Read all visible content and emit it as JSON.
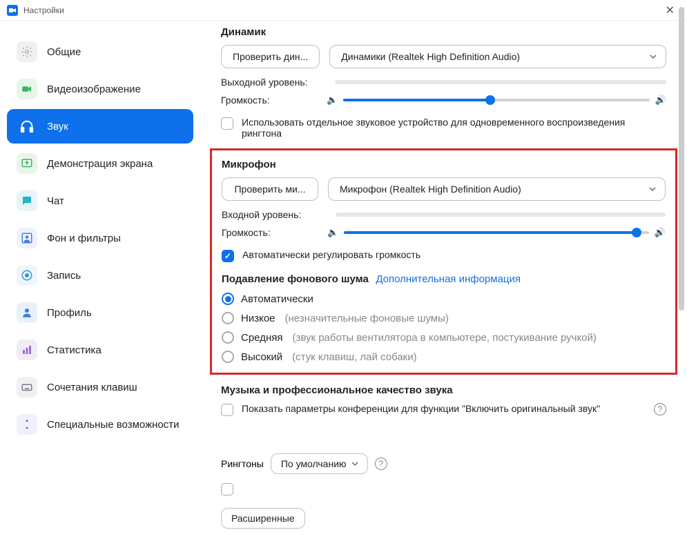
{
  "window": {
    "title": "Настройки"
  },
  "sidebar": {
    "items": [
      {
        "label": "Общие"
      },
      {
        "label": "Видеоизображение"
      },
      {
        "label": "Звук"
      },
      {
        "label": "Демонстрация экрана"
      },
      {
        "label": "Чат"
      },
      {
        "label": "Фон и фильтры"
      },
      {
        "label": "Запись"
      },
      {
        "label": "Профиль"
      },
      {
        "label": "Статистика"
      },
      {
        "label": "Сочетания клавиш"
      },
      {
        "label": "Специальные возможности"
      }
    ]
  },
  "speaker": {
    "heading": "Динамик",
    "test_btn": "Проверить дин...",
    "device": "Динамики (Realtek High Definition Audio)",
    "output_level_label": "Выходной уровень:",
    "volume_label": "Громкость:",
    "volume_percent": 48,
    "separate_ringer_label": "Использовать отдельное звуковое устройство для одновременного воспроизведения рингтона"
  },
  "mic": {
    "heading": "Микрофон",
    "test_btn": "Проверить ми...",
    "device": "Микрофон (Realtek High Definition Audio)",
    "input_level_label": "Входной уровень:",
    "volume_label": "Громкость:",
    "volume_percent": 96,
    "auto_adjust_label": "Автоматически регулировать громкость",
    "noise_heading": "Подавление фонового шума",
    "noise_link": "Дополнительная информация",
    "opts": [
      {
        "label": "Автоматически",
        "hint": ""
      },
      {
        "label": "Низкое",
        "hint": "(незначительные фоновые шумы)"
      },
      {
        "label": "Средняя",
        "hint": "(звук работы вентилятора в компьютере, постукивание ручкой)"
      },
      {
        "label": "Высокий",
        "hint": "(стук клавиш, лай собаки)"
      }
    ]
  },
  "music": {
    "heading": "Музыка и профессиональное качество звука",
    "original_sound_label": "Показать параметры конференции для функции \"Включить оригинальный звук\""
  },
  "ringtones": {
    "label": "Рингтоны",
    "value": "По умолчанию"
  },
  "advanced_btn": "Расширенные"
}
